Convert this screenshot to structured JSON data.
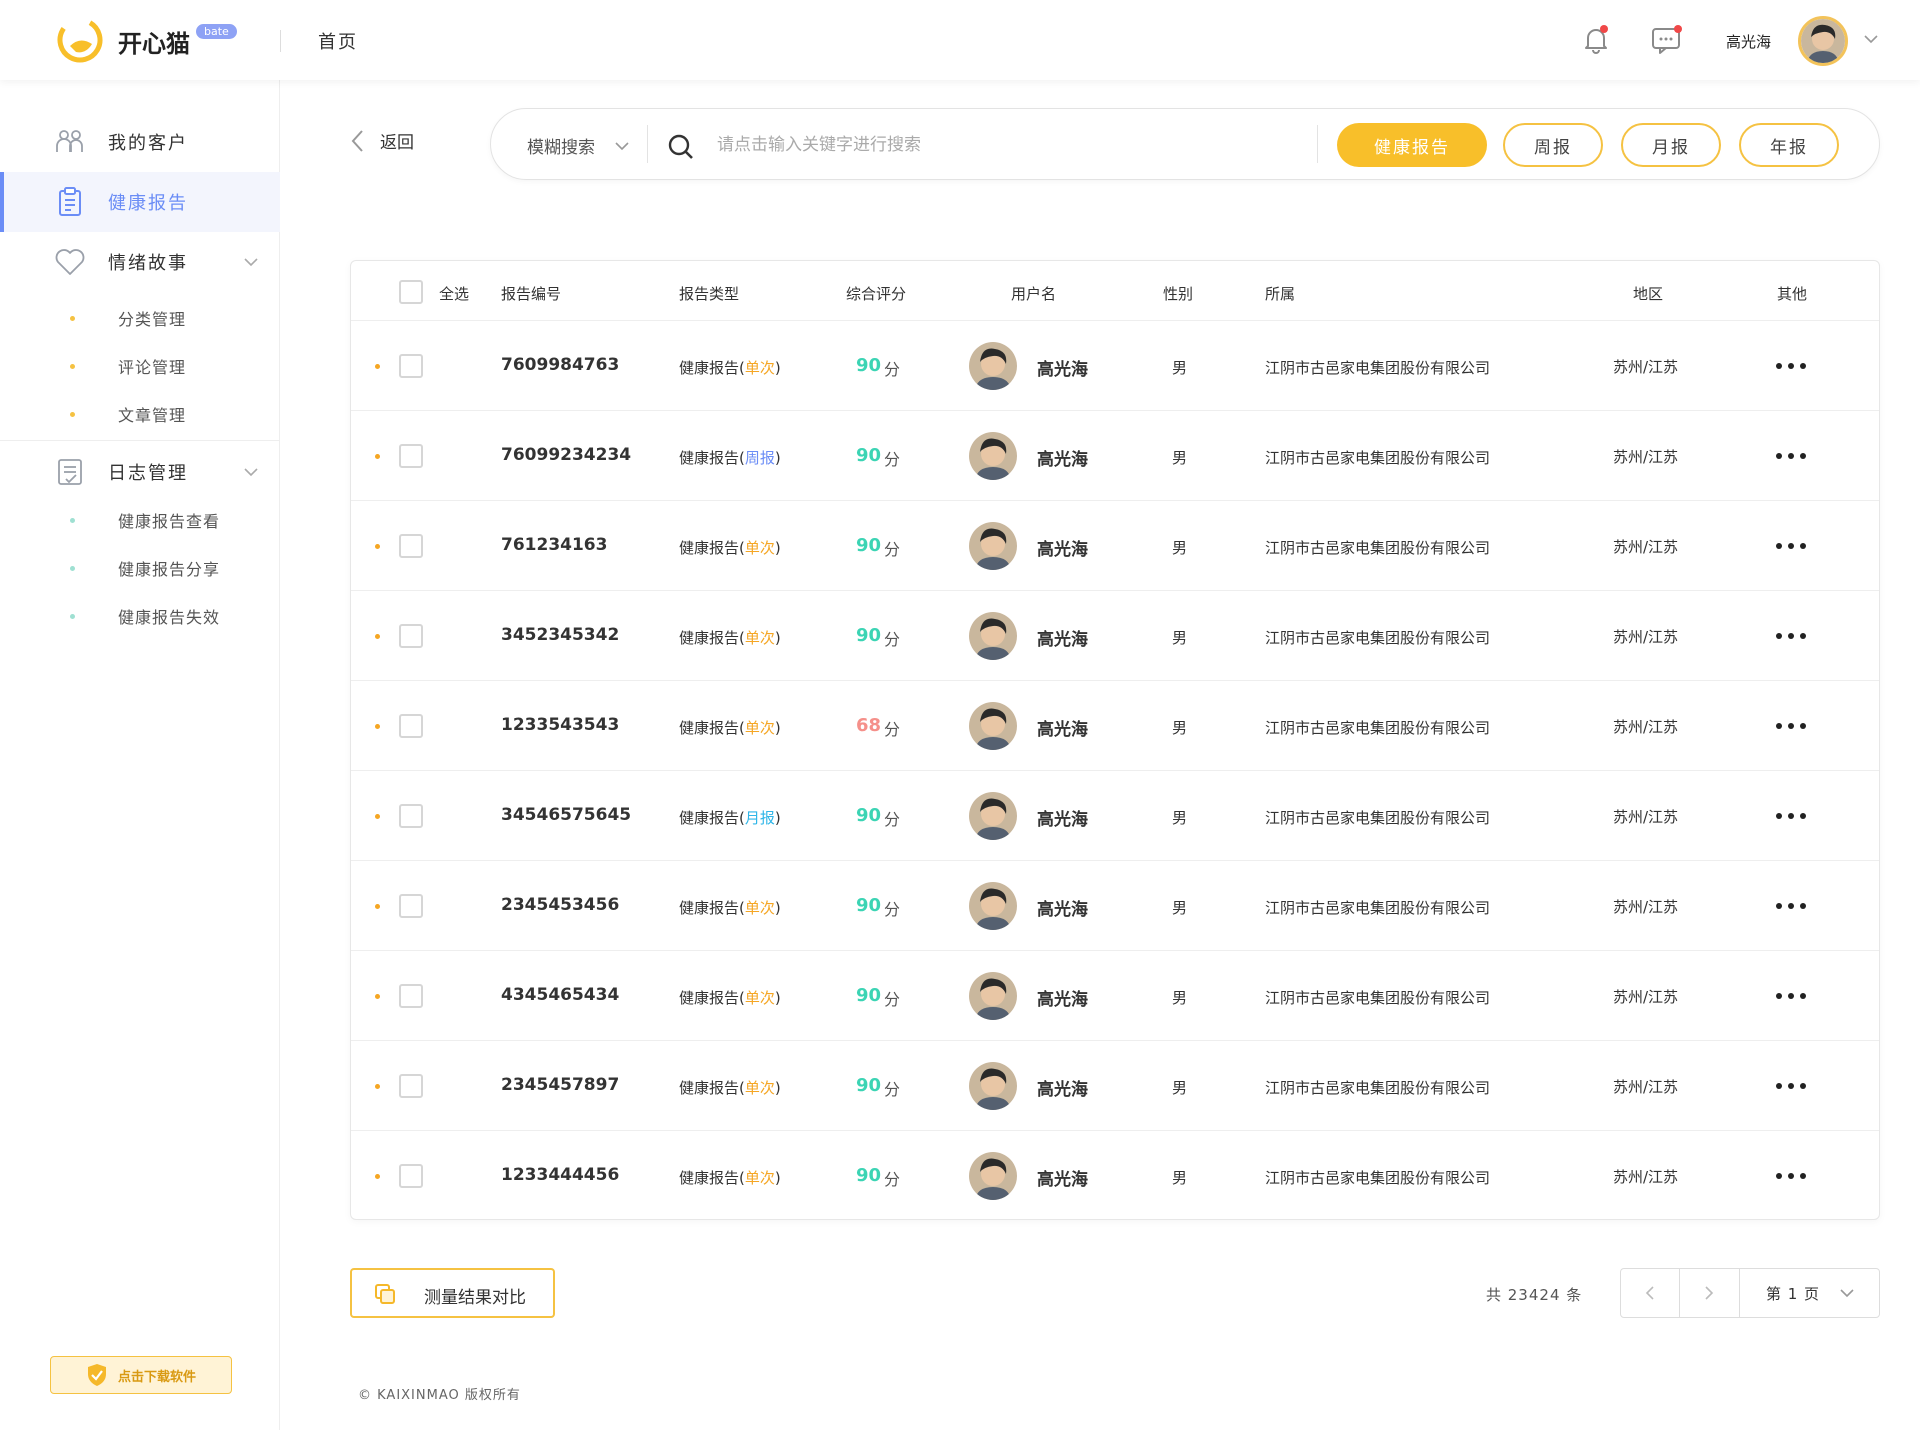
{
  "topbar": {
    "brand": "开心猫",
    "badge": "bate",
    "home": "首页",
    "username": "高光海"
  },
  "sidebar": {
    "items": [
      {
        "label": "我的客户"
      },
      {
        "label": "健康报告"
      },
      {
        "label": "情绪故事"
      },
      {
        "label": "日志管理"
      }
    ],
    "story_sub": [
      "分类管理",
      "评论管理",
      "文章管理"
    ],
    "log_sub": [
      "健康报告查看",
      "健康报告分享",
      "健康报告失效"
    ],
    "download": "点击下载软件"
  },
  "search": {
    "back": "返回",
    "mode": "模糊搜索",
    "placeholder": "请点击输入关键字进行搜索",
    "tabs": [
      "健康报告",
      "周报",
      "月报",
      "年报"
    ]
  },
  "table": {
    "select_all": "全选",
    "headers": [
      "报告编号",
      "报告类型",
      "综合评分",
      "用户名",
      "性别",
      "所属",
      "地区",
      "其他"
    ],
    "type_prefix": "健康报告",
    "score_unit": "分",
    "rows": [
      {
        "id": "7609984763",
        "kind": "单次",
        "kind_color": "#f5a623",
        "score": "90",
        "score_color": "#3cd4b4",
        "user": "高光海",
        "gender": "男",
        "org": "江阴市古邑家电集团股份有限公司",
        "region": "苏州/江苏"
      },
      {
        "id": "76099234234",
        "kind": "周报",
        "kind_color": "#6b8df6",
        "score": "90",
        "score_color": "#3cd4b4",
        "user": "高光海",
        "gender": "男",
        "org": "江阴市古邑家电集团股份有限公司",
        "region": "苏州/江苏"
      },
      {
        "id": "761234163",
        "kind": "单次",
        "kind_color": "#f5a623",
        "score": "90",
        "score_color": "#3cd4b4",
        "user": "高光海",
        "gender": "男",
        "org": "江阴市古邑家电集团股份有限公司",
        "region": "苏州/江苏"
      },
      {
        "id": "3452345342",
        "kind": "单次",
        "kind_color": "#f5a623",
        "score": "90",
        "score_color": "#3cd4b4",
        "user": "高光海",
        "gender": "男",
        "org": "江阴市古邑家电集团股份有限公司",
        "region": "苏州/江苏"
      },
      {
        "id": "1233543543",
        "kind": "单次",
        "kind_color": "#f5a623",
        "score": "68",
        "score_color": "#f5908a",
        "user": "高光海",
        "gender": "男",
        "org": "江阴市古邑家电集团股份有限公司",
        "region": "苏州/江苏"
      },
      {
        "id": "34546575645",
        "kind": "月报",
        "kind_color": "#2fb6e8",
        "score": "90",
        "score_color": "#3cd4b4",
        "user": "高光海",
        "gender": "男",
        "org": "江阴市古邑家电集团股份有限公司",
        "region": "苏州/江苏"
      },
      {
        "id": "2345453456",
        "kind": "单次",
        "kind_color": "#f5a623",
        "score": "90",
        "score_color": "#3cd4b4",
        "user": "高光海",
        "gender": "男",
        "org": "江阴市古邑家电集团股份有限公司",
        "region": "苏州/江苏"
      },
      {
        "id": "4345465434",
        "kind": "单次",
        "kind_color": "#f5a623",
        "score": "90",
        "score_color": "#3cd4b4",
        "user": "高光海",
        "gender": "男",
        "org": "江阴市古邑家电集团股份有限公司",
        "region": "苏州/江苏"
      },
      {
        "id": "2345457897",
        "kind": "单次",
        "kind_color": "#f5a623",
        "score": "90",
        "score_color": "#3cd4b4",
        "user": "高光海",
        "gender": "男",
        "org": "江阴市古邑家电集团股份有限公司",
        "region": "苏州/江苏"
      },
      {
        "id": "1233444456",
        "kind": "单次",
        "kind_color": "#f5a623",
        "score": "90",
        "score_color": "#3cd4b4",
        "user": "高光海",
        "gender": "男",
        "org": "江阴市古邑家电集团股份有限公司",
        "region": "苏州/江苏"
      }
    ]
  },
  "footer": {
    "compare": "测量结果对比",
    "total": "共 23424 条",
    "page_label": "第 1 页",
    "copyright": "© KAIXINMAO 版权所有"
  },
  "colors": {
    "accent": "#f8bf2a",
    "active": "#6b8df6",
    "score_good": "#3cd4b4",
    "score_low": "#f5908a"
  }
}
